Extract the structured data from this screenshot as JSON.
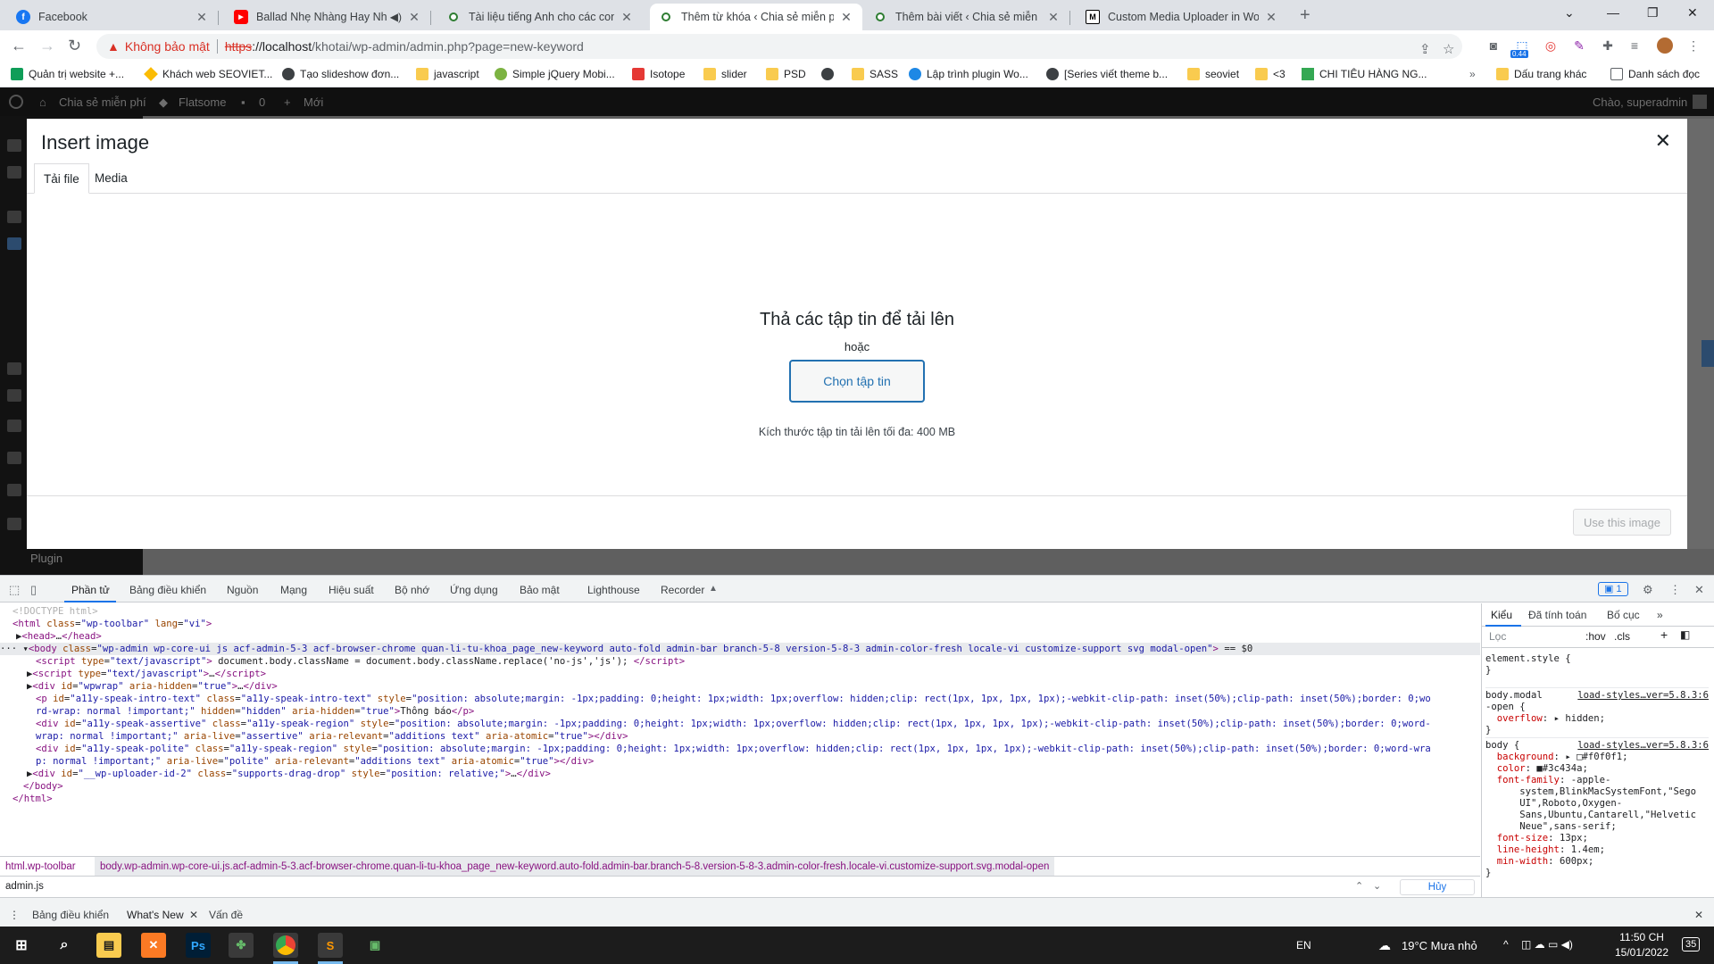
{
  "browser": {
    "tabs": [
      {
        "title": "Facebook",
        "fav_color": "#1877f2",
        "fav_glyph": "f"
      },
      {
        "title": "Ballad Nhẹ Nhàng Hay Nhất",
        "fav_color": "#ff0000",
        "fav_glyph": "▶"
      },
      {
        "title": "Tài liệu tiếng Anh cho các con – C",
        "fav_color": "#2e7d32",
        "fav_glyph": "●"
      },
      {
        "title": "Thêm từ khóa ‹ Chia sẻ miễn phí",
        "fav_color": "#2e7d32",
        "fav_glyph": "●"
      },
      {
        "title": "Thêm bài viết ‹ Chia sẻ miễn phí",
        "fav_color": "#2e7d32",
        "fav_glyph": "●"
      },
      {
        "title": "Custom Media Uploader in Word",
        "fav_color": "#000000",
        "fav_glyph": "M"
      }
    ],
    "security_label": "Không bảo mật",
    "url_scheme": "https",
    "url_host": "://localhost",
    "url_path": "/khotai/wp-admin/admin.php?page=new-keyword",
    "ext_badge": "0.44",
    "bookmarks": [
      "Quản trị website +...",
      "Khách web SEOVIET...",
      "Tạo slideshow đơn...",
      "javascript",
      "Simple jQuery Mobi...",
      "Isotope",
      "slider",
      "PSD",
      "SASS",
      "Lập trình plugin Wo...",
      "[Series viết theme b...",
      "seoviet",
      "<3",
      "CHI TIÊU HÀNG NG...",
      "Dấu trang khác",
      "Danh sách đọc"
    ]
  },
  "wp": {
    "site_name": "Chia sẻ miễn phí",
    "theme": "Flatsome",
    "comments": "0",
    "new_label": "Mới",
    "greeting": "Chào, superadmin",
    "side_plugin": "Plugin"
  },
  "modal": {
    "title": "Insert image",
    "tab_upload": "Tải file",
    "tab_media": "Media",
    "drop_title": "Thả các tập tin để tải lên",
    "drop_or": "hoặc",
    "pick_button": "Chọn tập tin",
    "max_size": "Kích thước tập tin tải lên tối đa: 400 MB",
    "use_button": "Use this image"
  },
  "devtools": {
    "tabs": [
      "Phần tử",
      "Bảng điều khiển",
      "Nguồn",
      "Mạng",
      "Hiệu suất",
      "Bộ nhớ",
      "Ứng dụng",
      "Bảo mật",
      "Lighthouse",
      "Recorder"
    ],
    "issues_badge": "1",
    "styles_tabs": [
      "Kiểu",
      "Đã tính toán",
      "Bố cục"
    ],
    "filter_placeholder": "Lọc",
    "filter_hov": ":hov",
    "filter_cls": ".cls",
    "breadcrumb_1": "html.wp-toolbar",
    "breadcrumb_2": "body.wp-admin.wp-core-ui.js.acf-admin-5-3.acf-browser-chrome.quan-li-tu-khoa_page_new-keyword.auto-fold.admin-bar.branch-5-8.version-5-8-3.admin-color-fresh.locale-vi.customize-support.svg.modal-open",
    "search_value": "admin.js",
    "cancel_label": "Hủy",
    "drawer_tabs": [
      "Bảng điều khiển",
      "What's New",
      "Vấn đề"
    ]
  },
  "taskbar": {
    "lang": "EN",
    "weather": "19°C  Mưa nhỏ",
    "time": "11:50 CH",
    "date": "15/01/2022",
    "notifications": "35"
  }
}
